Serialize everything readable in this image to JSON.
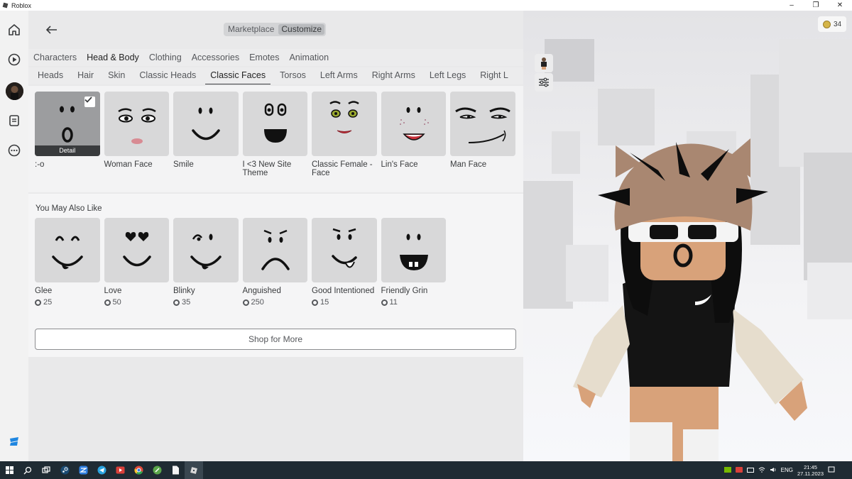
{
  "window": {
    "title": "Roblox",
    "controls": [
      "–",
      "❐",
      "✕"
    ]
  },
  "topbar": {
    "segments": [
      "Marketplace",
      "Customize"
    ],
    "active_segment": "Customize"
  },
  "category_tabs": [
    "Characters",
    "Head & Body",
    "Clothing",
    "Accessories",
    "Emotes",
    "Animation"
  ],
  "active_category": "Head & Body",
  "sub_tabs": [
    "Heads",
    "Hair",
    "Skin",
    "Classic Heads",
    "Classic Faces",
    "Torsos",
    "Left Arms",
    "Right Arms",
    "Left Legs",
    "Right L"
  ],
  "active_sub_tab": "Classic Faces",
  "owned_items": [
    {
      "name": ":-o",
      "face": "o",
      "selected": true,
      "detail_label": "Detail"
    },
    {
      "name": "Woman Face",
      "face": "woman"
    },
    {
      "name": "Smile",
      "face": "smile"
    },
    {
      "name": "I <3 New Site Theme",
      "face": "newsite"
    },
    {
      "name": "Classic Female - Face",
      "face": "female"
    },
    {
      "name": "Lin's Face",
      "face": "lin"
    },
    {
      "name": "Man Face",
      "face": "man"
    }
  ],
  "recommendations": {
    "title": "You May Also Like",
    "items": [
      {
        "name": "Glee",
        "price": "25",
        "face": "glee"
      },
      {
        "name": "Love",
        "price": "50",
        "face": "love"
      },
      {
        "name": "Blinky",
        "price": "35",
        "face": "blinky"
      },
      {
        "name": "Anguished",
        "price": "250",
        "face": "anguished"
      },
      {
        "name": "Good Intentioned",
        "price": "15",
        "face": "good"
      },
      {
        "name": "Friendly Grin",
        "price": "11",
        "face": "grin"
      }
    ],
    "shop_button": "Shop for More"
  },
  "currency": {
    "amount": "34"
  },
  "taskbar": {
    "language": "ENG",
    "time": "21:45",
    "date": "27.11.2023"
  },
  "icons": {
    "rail": [
      "home-icon",
      "play-icon",
      "avatar",
      "chat-icon",
      "more-icon",
      "roblox-logo-icon"
    ],
    "preview_tools": [
      "avatar-mini-icon",
      "sliders-icon"
    ]
  },
  "colors": {
    "selected_bg": "#9c9d9f",
    "card_bg": "#d8d8d9",
    "taskbar_bg": "#1f2b33"
  }
}
